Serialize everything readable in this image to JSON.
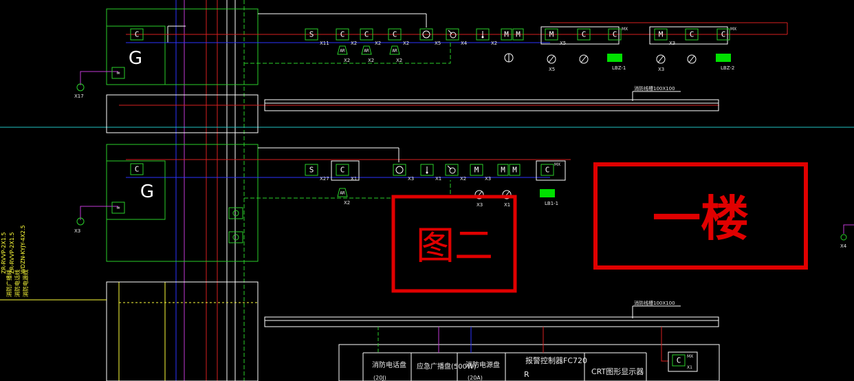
{
  "colors": {
    "background": "#000000",
    "white_line": "#ffffff",
    "green_line": "#2ad12a",
    "red_line": "#d81f1f",
    "blue_line": "#2b35ff",
    "magenta_line": "#c23ad6",
    "cyan_line": "#22c3c3",
    "yellow_line": "#ffff3a",
    "annotation_red": "#e00000",
    "module_fill": "#00e000"
  },
  "floor_label": "一楼",
  "figure_label": "图二",
  "trunk_labels": {
    "upper": "消防线槽100X100",
    "lower": "消防线槽100X100"
  },
  "cable_labels": [
    "ZR-RVVP-2X1.5",
    "ZR-RVVP-2X1.5",
    "WDZN-KYJY-4X2.5"
  ],
  "cable_names": [
    "消防广播线",
    "消防电话线",
    "消防电源线"
  ],
  "upper_row": {
    "devices": [
      {
        "type": "S",
        "label": "X11"
      },
      {
        "type": "C",
        "label": "X2"
      },
      {
        "type": "C",
        "label": "X2"
      },
      {
        "type": "C",
        "label": "X2"
      },
      {
        "type": "circle",
        "label": "X5"
      },
      {
        "type": "valve",
        "label": "X4"
      },
      {
        "type": "thermo",
        "label": "X2"
      },
      {
        "type": "MM",
        "label": ""
      },
      {
        "type": "M",
        "label": "X5"
      },
      {
        "type": "C",
        "label": ""
      },
      {
        "type": "C",
        "label": "MX"
      },
      {
        "type": "M",
        "label": "X3"
      },
      {
        "type": "C",
        "label": ""
      },
      {
        "type": "C",
        "label": "MX"
      }
    ],
    "alarm_labels": [
      "X2",
      "X2",
      "X2"
    ],
    "lower_labels": [
      "X5",
      "",
      "LBZ-1",
      "X3",
      "",
      "LBZ-2"
    ],
    "left_tag": "X17"
  },
  "lower_row": {
    "devices": [
      {
        "type": "S",
        "label": "X27"
      },
      {
        "type": "C",
        "label": "X1"
      },
      {
        "type": "circle",
        "label": "X3"
      },
      {
        "type": "thermo",
        "label": "X1"
      },
      {
        "type": "valve",
        "label": "X2"
      },
      {
        "type": "M",
        "label": "X3"
      },
      {
        "type": "MM",
        "label": ""
      },
      {
        "type": "C",
        "label": "MX"
      }
    ],
    "alarm_labels": [
      "X2"
    ],
    "lower_labels": [
      "X3",
      "X1",
      "LB1-1"
    ],
    "left_tag": "X3"
  },
  "right_tag": "X4",
  "bottom_panels": {
    "phone": {
      "title": "消防电话盘",
      "sub": "(20J)"
    },
    "broadcast": {
      "title": "应急广播盘(500W)",
      "sub": ""
    },
    "power": {
      "title": "消防电源盘",
      "sub": "(20A)"
    },
    "controller": {
      "title": "报警控制器FC720",
      "sub": "R"
    },
    "crt": {
      "title": "CRT图形显示器",
      "sub": ""
    }
  },
  "bottom_module": {
    "type": "C",
    "label": "MX",
    "sub": "X1"
  }
}
